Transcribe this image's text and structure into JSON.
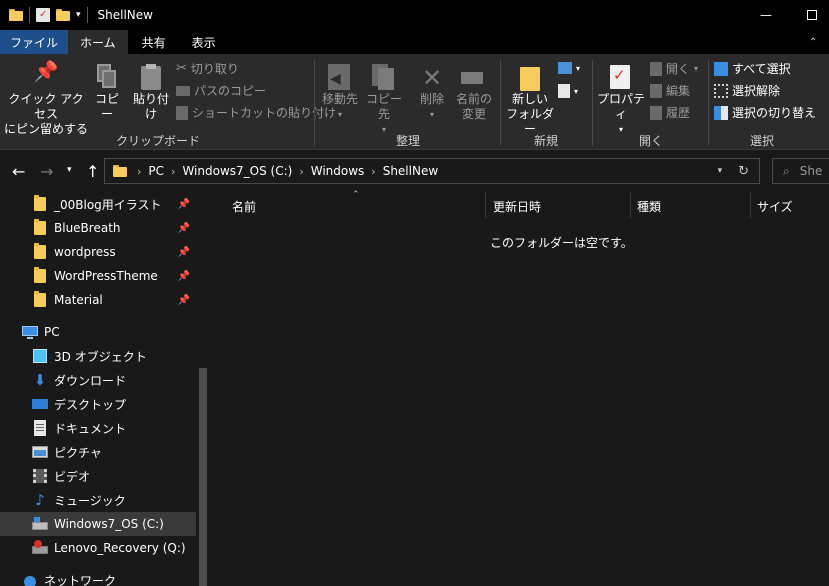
{
  "window": {
    "title": "ShellNew",
    "minimize_glyph": "—",
    "maximize_glyph": "☐"
  },
  "menu_tabs": [
    {
      "label": "ファイル"
    },
    {
      "label": "ホーム"
    },
    {
      "label": "共有"
    },
    {
      "label": "表示"
    }
  ],
  "ribbon": {
    "clipboard": {
      "pin_label_1": "クイック アクセス",
      "pin_label_2": "にピン留めする",
      "copy": "コピー",
      "paste": "貼り付け",
      "cut": "切り取り",
      "copy_path": "パスのコピー",
      "paste_shortcut": "ショートカットの貼り付け",
      "group": "クリップボード"
    },
    "organize": {
      "move_to": "移動先",
      "copy_to": "コピー先",
      "delete": "削除",
      "rename_1": "名前の",
      "rename_2": "変更",
      "group": "整理"
    },
    "new": {
      "new_folder_1": "新しい",
      "new_folder_2": "フォルダー",
      "group": "新規"
    },
    "open": {
      "properties": "プロパティ",
      "open": "開く",
      "edit": "編集",
      "history": "履歴",
      "group": "開く"
    },
    "select": {
      "select_all": "すべて選択",
      "select_none": "選択解除",
      "invert": "選択の切り替え",
      "group": "選択"
    }
  },
  "address": {
    "crumbs": [
      "PC",
      "Windows7_OS (C:)",
      "Windows",
      "ShellNew"
    ],
    "search_placeholder": "She"
  },
  "nav_pane": {
    "quick_access": [
      {
        "label": "_00Blog用イラスト",
        "icon": "folder-icon",
        "pinned": true
      },
      {
        "label": "BlueBreath",
        "icon": "folder-icon",
        "pinned": true
      },
      {
        "label": "wordpress",
        "icon": "folder-icon",
        "pinned": true
      },
      {
        "label": "WordPressTheme",
        "icon": "folder-icon",
        "pinned": true
      },
      {
        "label": "Material",
        "icon": "folder-icon",
        "pinned": true
      }
    ],
    "pc": {
      "label": "PC",
      "icon": "pc-icon"
    },
    "pc_items": [
      {
        "label": "3D オブジェクト",
        "icon": "3d-objects-icon"
      },
      {
        "label": "ダウンロード",
        "icon": "download-icon"
      },
      {
        "label": "デスクトップ",
        "icon": "desktop-icon"
      },
      {
        "label": "ドキュメント",
        "icon": "document-icon"
      },
      {
        "label": "ピクチャ",
        "icon": "pictures-icon"
      },
      {
        "label": "ビデオ",
        "icon": "video-icon"
      },
      {
        "label": "ミュージック",
        "icon": "music-icon"
      },
      {
        "label": "Windows7_OS (C:)",
        "icon": "drive-icon",
        "selected": true
      },
      {
        "label": "Lenovo_Recovery (Q:)",
        "icon": "recovery-drive-icon"
      }
    ],
    "network": {
      "label": "ネットワーク",
      "icon": "network-icon"
    }
  },
  "columns": [
    {
      "label": "名前"
    },
    {
      "label": "更新日時"
    },
    {
      "label": "種類"
    },
    {
      "label": "サイズ"
    }
  ],
  "empty_message": "このフォルダーは空です。",
  "colors": {
    "background": "#191919",
    "ribbon": "#2b2b2b",
    "file_tab": "#1f4e8c",
    "folder": "#f6cd5c",
    "accent_blue": "#3a8ee6"
  }
}
